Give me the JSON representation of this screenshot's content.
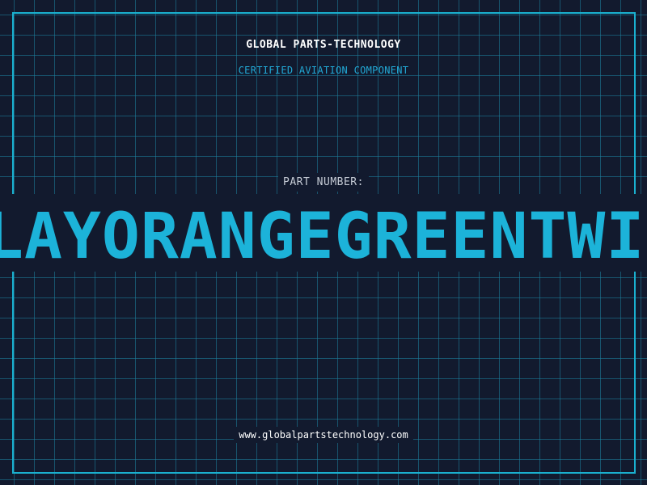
{
  "header": {
    "company": "GLOBAL PARTS-TECHNOLOGY",
    "subtitle": "CERTIFIED AVIATION COMPONENT"
  },
  "part": {
    "label": "PART NUMBER:",
    "value": "LAYORANGEGREENTWIS"
  },
  "footer": {
    "url": "www.globalpartstechnology.com"
  },
  "colors": {
    "background": "#121a2e",
    "grid": "#1e82a0",
    "accent": "#1cb3d9",
    "text": "#ffffff",
    "muted": "#c6ccd6"
  }
}
